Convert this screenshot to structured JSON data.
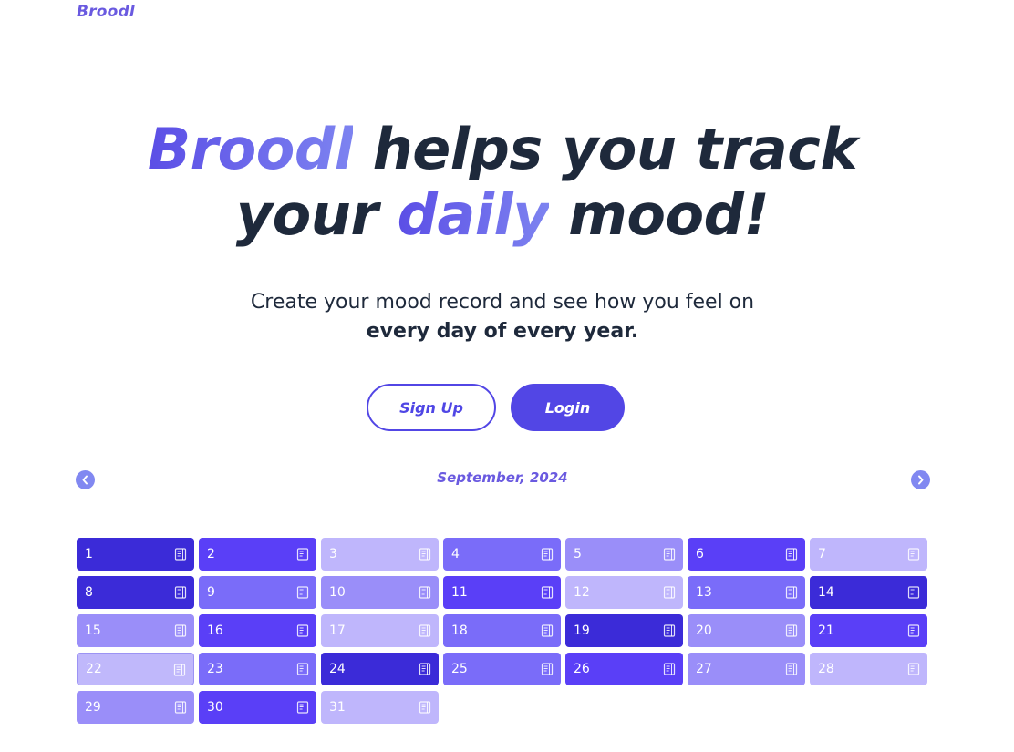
{
  "header": {
    "logo": "Broodl"
  },
  "hero": {
    "brand": "Broodl",
    "line1_rest": "helps you track",
    "line2_prefix": "your",
    "highlight": "daily",
    "line2_suffix": "mood!"
  },
  "subtitle": {
    "line1": "Create your mood record and see how you feel on",
    "line2": "every day of every year."
  },
  "buttons": {
    "signup": "Sign Up",
    "login": "Login"
  },
  "calendar": {
    "month_label": "September, 2024",
    "prev_icon": "chevron-left-icon",
    "next_icon": "chevron-right-icon",
    "day_icon": "notebook-icon",
    "colors": {
      "1": "#3b2bd8",
      "2": "#5a3ff7",
      "3": "#7a6cf9",
      "4": "#9a8ef9",
      "5": "#bfb6fc"
    },
    "days": [
      {
        "label": "1",
        "mood": 1
      },
      {
        "label": "2",
        "mood": 2
      },
      {
        "label": "3",
        "mood": 5
      },
      {
        "label": "4",
        "mood": 3
      },
      {
        "label": "5",
        "mood": 4
      },
      {
        "label": "6",
        "mood": 2
      },
      {
        "label": "7",
        "mood": 5
      },
      {
        "label": "8",
        "mood": 1
      },
      {
        "label": "9",
        "mood": 3
      },
      {
        "label": "10",
        "mood": 4
      },
      {
        "label": "11",
        "mood": 2
      },
      {
        "label": "12",
        "mood": 5
      },
      {
        "label": "13",
        "mood": 3
      },
      {
        "label": "14",
        "mood": 1
      },
      {
        "label": "15",
        "mood": 4
      },
      {
        "label": "16",
        "mood": 2
      },
      {
        "label": "17",
        "mood": 5
      },
      {
        "label": "18",
        "mood": 3
      },
      {
        "label": "19",
        "mood": 1
      },
      {
        "label": "20",
        "mood": 4
      },
      {
        "label": "21",
        "mood": 2
      },
      {
        "label": "22",
        "mood": 5,
        "highlighted": true
      },
      {
        "label": "23",
        "mood": 3
      },
      {
        "label": "24",
        "mood": 1
      },
      {
        "label": "25",
        "mood": 3
      },
      {
        "label": "26",
        "mood": 2
      },
      {
        "label": "27",
        "mood": 4
      },
      {
        "label": "28",
        "mood": 5
      },
      {
        "label": "29",
        "mood": 4
      },
      {
        "label": "30",
        "mood": 2
      },
      {
        "label": "31",
        "mood": 5
      }
    ]
  }
}
